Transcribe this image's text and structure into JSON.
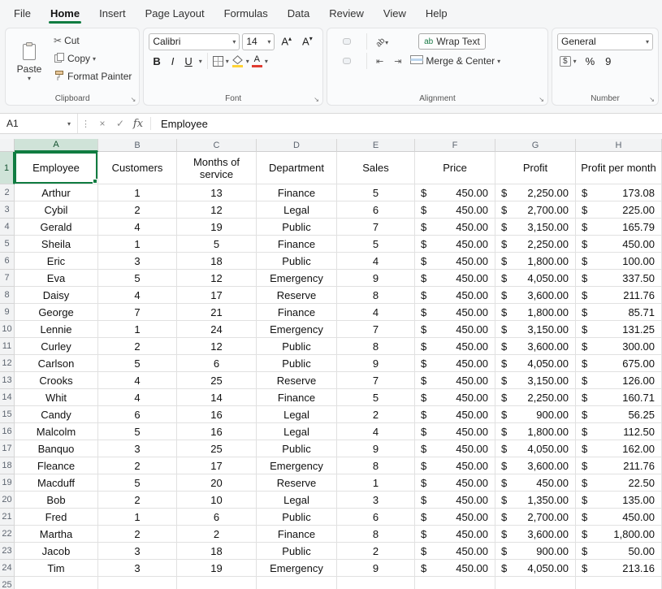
{
  "menu": {
    "tabs": [
      "File",
      "Home",
      "Insert",
      "Page Layout",
      "Formulas",
      "Data",
      "Review",
      "View",
      "Help"
    ],
    "active_tab": "Home"
  },
  "ribbon": {
    "clipboard": {
      "group_label": "Clipboard",
      "paste_label": "Paste",
      "cut_label": "Cut",
      "copy_label": "Copy",
      "format_painter_label": "Format Painter"
    },
    "font": {
      "group_label": "Font",
      "font_name": "Calibri",
      "font_size": "14",
      "bold": "B",
      "italic": "I",
      "underline": "U",
      "grow_font": "A",
      "shrink_font": "A",
      "font_color_letter": "A",
      "font_color_hex": "#e03c32",
      "fill_color_hex": "#ffd335"
    },
    "alignment": {
      "group_label": "Alignment",
      "orientation_label": "ab",
      "wrap_icon_label": "ab",
      "wrap_text_label": "Wrap Text",
      "merge_center_label": "Merge & Center"
    },
    "number": {
      "group_label": "Number",
      "format_value": "General",
      "accounting_label": "$",
      "percent_label": "%",
      "comma_label": "9"
    }
  },
  "formula_bar": {
    "name_box": "A1",
    "cancel_icon": "×",
    "enter_icon": "✓",
    "fx_label": "fx",
    "content": "Employee"
  },
  "sheet": {
    "selected_cell": "A1",
    "currency_symbol": "$",
    "accounting_columns": [
      5,
      6,
      7
    ],
    "columns": [
      "A",
      "B",
      "C",
      "D",
      "E",
      "F",
      "G",
      "H"
    ],
    "header_row": [
      "Employee",
      "Customers",
      "Months of service",
      "Department",
      "Sales",
      "Price",
      "Profit",
      "Profit per month"
    ],
    "rows": [
      [
        "Arthur",
        "1",
        "13",
        "Finance",
        "5",
        "450.00",
        "2,250.00",
        "173.08"
      ],
      [
        "Cybil",
        "2",
        "12",
        "Legal",
        "6",
        "450.00",
        "2,700.00",
        "225.00"
      ],
      [
        "Gerald",
        "4",
        "19",
        "Public",
        "7",
        "450.00",
        "3,150.00",
        "165.79"
      ],
      [
        "Sheila",
        "1",
        "5",
        "Finance",
        "5",
        "450.00",
        "2,250.00",
        "450.00"
      ],
      [
        "Eric",
        "3",
        "18",
        "Public",
        "4",
        "450.00",
        "1,800.00",
        "100.00"
      ],
      [
        "Eva",
        "5",
        "12",
        "Emergency",
        "9",
        "450.00",
        "4,050.00",
        "337.50"
      ],
      [
        "Daisy",
        "4",
        "17",
        "Reserve",
        "8",
        "450.00",
        "3,600.00",
        "211.76"
      ],
      [
        "George",
        "7",
        "21",
        "Finance",
        "4",
        "450.00",
        "1,800.00",
        "85.71"
      ],
      [
        "Lennie",
        "1",
        "24",
        "Emergency",
        "7",
        "450.00",
        "3,150.00",
        "131.25"
      ],
      [
        "Curley",
        "2",
        "12",
        "Public",
        "8",
        "450.00",
        "3,600.00",
        "300.00"
      ],
      [
        "Carlson",
        "5",
        "6",
        "Public",
        "9",
        "450.00",
        "4,050.00",
        "675.00"
      ],
      [
        "Crooks",
        "4",
        "25",
        "Reserve",
        "7",
        "450.00",
        "3,150.00",
        "126.00"
      ],
      [
        "Whit",
        "4",
        "14",
        "Finance",
        "5",
        "450.00",
        "2,250.00",
        "160.71"
      ],
      [
        "Candy",
        "6",
        "16",
        "Legal",
        "2",
        "450.00",
        "900.00",
        "56.25"
      ],
      [
        "Malcolm",
        "5",
        "16",
        "Legal",
        "4",
        "450.00",
        "1,800.00",
        "112.50"
      ],
      [
        "Banquo",
        "3",
        "25",
        "Public",
        "9",
        "450.00",
        "4,050.00",
        "162.00"
      ],
      [
        "Fleance",
        "2",
        "17",
        "Emergency",
        "8",
        "450.00",
        "3,600.00",
        "211.76"
      ],
      [
        "Macduff",
        "5",
        "20",
        "Reserve",
        "1",
        "450.00",
        "450.00",
        "22.50"
      ],
      [
        "Bob",
        "2",
        "10",
        "Legal",
        "3",
        "450.00",
        "1,350.00",
        "135.00"
      ],
      [
        "Fred",
        "1",
        "6",
        "Public",
        "6",
        "450.00",
        "2,700.00",
        "450.00"
      ],
      [
        "Martha",
        "2",
        "2",
        "Finance",
        "8",
        "450.00",
        "3,600.00",
        "1,800.00"
      ],
      [
        "Jacob",
        "3",
        "18",
        "Public",
        "2",
        "450.00",
        "900.00",
        "50.00"
      ],
      [
        "Tim",
        "3",
        "19",
        "Emergency",
        "9",
        "450.00",
        "4,050.00",
        "213.16"
      ]
    ]
  }
}
